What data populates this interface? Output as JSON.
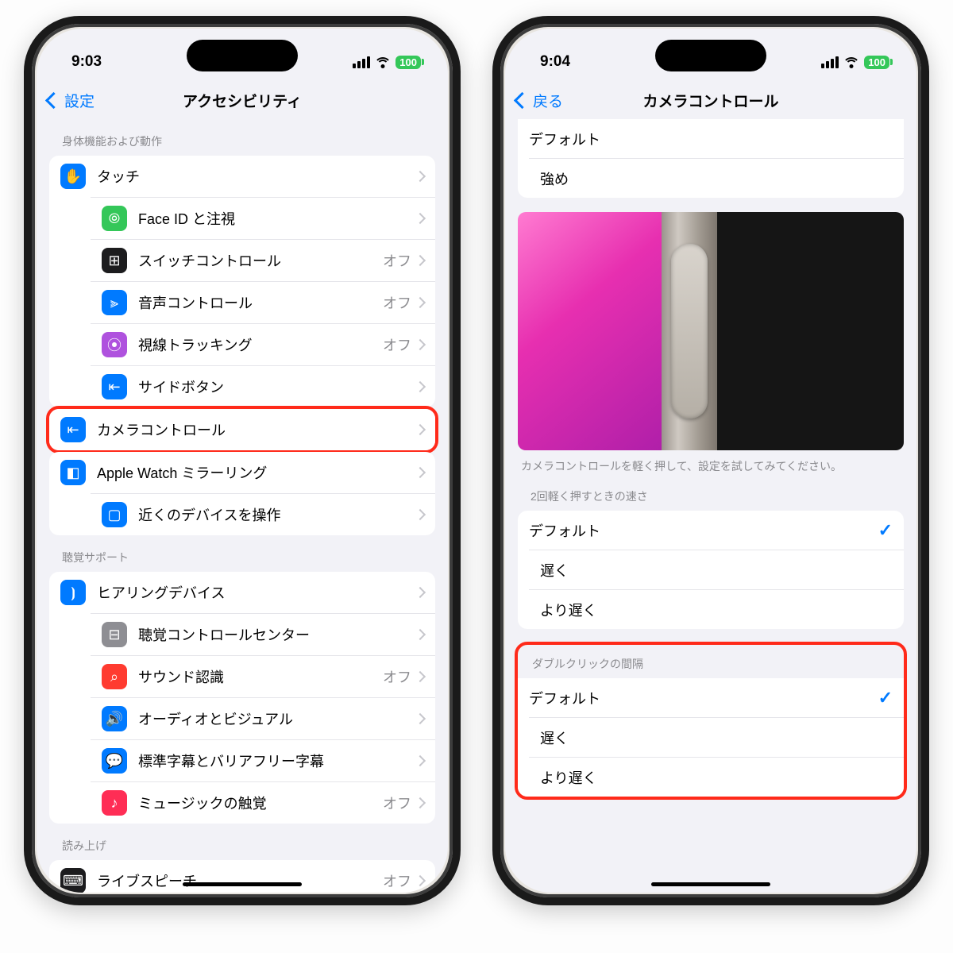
{
  "left": {
    "time": "9:03",
    "battery": "100",
    "back": "設定",
    "title": "アクセシビリティ",
    "s1_header": "身体機能および動作",
    "s1": [
      {
        "label": "タッチ",
        "value": "",
        "color": "bg-blue",
        "glyph": "✋"
      },
      {
        "label": "Face ID と注視",
        "value": "",
        "color": "bg-green",
        "glyph": "⦾"
      },
      {
        "label": "スイッチコントロール",
        "value": "オフ",
        "color": "bg-black",
        "glyph": "⊞"
      },
      {
        "label": "音声コントロール",
        "value": "オフ",
        "color": "bg-blue",
        "glyph": "⫸"
      },
      {
        "label": "視線トラッキング",
        "value": "オフ",
        "color": "bg-purple",
        "glyph": "⦿"
      },
      {
        "label": "サイドボタン",
        "value": "",
        "color": "bg-blue",
        "glyph": "⇤"
      },
      {
        "label": "カメラコントロール",
        "value": "",
        "color": "bg-blue",
        "glyph": "⇤"
      },
      {
        "label": "Apple Watch ミラーリング",
        "value": "",
        "color": "bg-blue",
        "glyph": "◧"
      },
      {
        "label": "近くのデバイスを操作",
        "value": "",
        "color": "bg-blue",
        "glyph": "▢"
      }
    ],
    "s2_header": "聴覚サポート",
    "s2": [
      {
        "label": "ヒアリングデバイス",
        "value": "",
        "color": "bg-blue",
        "glyph": "⦘"
      },
      {
        "label": "聴覚コントロールセンター",
        "value": "",
        "color": "bg-grey",
        "glyph": "⊟"
      },
      {
        "label": "サウンド認識",
        "value": "オフ",
        "color": "bg-red",
        "glyph": "⌕"
      },
      {
        "label": "オーディオとビジュアル",
        "value": "",
        "color": "bg-blue",
        "glyph": "🔊"
      },
      {
        "label": "標準字幕とバリアフリー字幕",
        "value": "",
        "color": "bg-blue",
        "glyph": "💬"
      },
      {
        "label": "ミュージックの触覚",
        "value": "オフ",
        "color": "bg-pink",
        "glyph": "♪"
      }
    ],
    "s3_header": "読み上げ",
    "s3": [
      {
        "label": "ライブスピーチ",
        "value": "オフ",
        "color": "bg-black",
        "glyph": "⌨"
      }
    ]
  },
  "right": {
    "time": "9:04",
    "battery": "100",
    "back": "戻る",
    "title": "カメラコントロール",
    "topOptions": [
      "デフォルト",
      "強め"
    ],
    "caption": "カメラコントロールを軽く押して、設定を試してみてください。",
    "speed_header": "2回軽く押すときの速さ",
    "speed_options": [
      {
        "label": "デフォルト",
        "checked": true
      },
      {
        "label": "遅く",
        "checked": false
      },
      {
        "label": "より遅く",
        "checked": false
      }
    ],
    "double_header": "ダブルクリックの間隔",
    "double_options": [
      {
        "label": "デフォルト",
        "checked": true
      },
      {
        "label": "遅く",
        "checked": false
      },
      {
        "label": "より遅く",
        "checked": false
      }
    ]
  }
}
